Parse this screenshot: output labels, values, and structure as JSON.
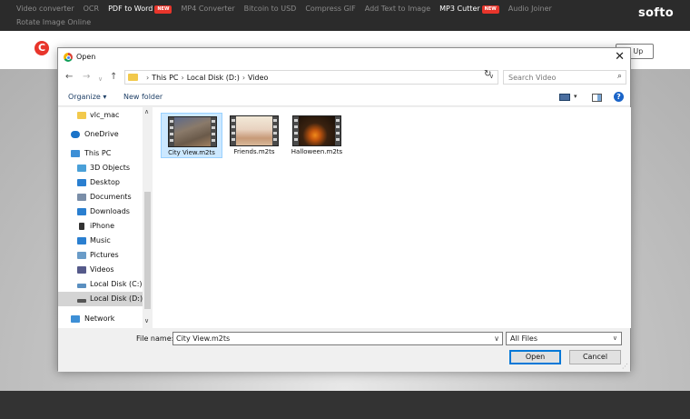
{
  "website": {
    "nav": [
      {
        "label": "Video converter"
      },
      {
        "label": "OCR"
      },
      {
        "label": "PDF to Word",
        "highlight": true,
        "badge": "NEW"
      },
      {
        "label": "MP4 Converter"
      },
      {
        "label": "Bitcoin to USD"
      },
      {
        "label": "Compress GIF"
      },
      {
        "label": "Add Text to Image"
      },
      {
        "label": "MP3 Cutter",
        "highlight": true,
        "badge": "NEW"
      },
      {
        "label": "Audio Joiner"
      }
    ],
    "nav_row2": "Rotate Image Online",
    "logo": "softo",
    "brand_icon_letter": "C",
    "signup_label": "n Up"
  },
  "dialog": {
    "title": "Open",
    "close_glyph": "✕",
    "address": {
      "crumbs": [
        "This PC",
        "Local Disk (D:)",
        "Video"
      ],
      "search_placeholder": "Search Video"
    },
    "toolbar": {
      "organize": "Organize ▾",
      "new_folder": "New folder",
      "help": "?"
    },
    "nav_pane": [
      {
        "label": "vlc_mac",
        "icon": "folder-icon",
        "color": "#f2c94c"
      },
      {
        "label": "OneDrive",
        "icon": "cloud-icon",
        "color": "#1a73c8"
      },
      {
        "label": "This PC",
        "icon": "computer-icon",
        "color": "#3d8fd6"
      },
      {
        "label": "3D Objects",
        "icon": "cube-icon",
        "color": "#4aa0d8"
      },
      {
        "label": "Desktop",
        "icon": "desktop-icon",
        "color": "#2a7fd0"
      },
      {
        "label": "Documents",
        "icon": "document-icon",
        "color": "#7a8ea8"
      },
      {
        "label": "Downloads",
        "icon": "download-icon",
        "color": "#2a7fd0"
      },
      {
        "label": "iPhone",
        "icon": "phone-icon",
        "color": "#333333"
      },
      {
        "label": "Music",
        "icon": "music-icon",
        "color": "#2a7fd0"
      },
      {
        "label": "Pictures",
        "icon": "pictures-icon",
        "color": "#6a9cc8"
      },
      {
        "label": "Videos",
        "icon": "video-icon",
        "color": "#555a8a"
      },
      {
        "label": "Local Disk (C:)",
        "icon": "drive-icon",
        "color": "#5a8fc0"
      },
      {
        "label": "Local Disk (D:)",
        "icon": "drive-icon",
        "color": "#555555",
        "selected": true
      },
      {
        "label": "Network",
        "icon": "network-icon",
        "color": "#3d8fd6"
      }
    ],
    "files": [
      {
        "name": "City View.m2ts",
        "selected": true
      },
      {
        "name": "Friends.m2ts"
      },
      {
        "name": "Halloween.m2ts"
      }
    ],
    "bottom": {
      "file_name_label": "File name:",
      "file_name_value": "City View.m2ts",
      "filter": "All Files",
      "open": "Open",
      "cancel": "Cancel"
    }
  }
}
